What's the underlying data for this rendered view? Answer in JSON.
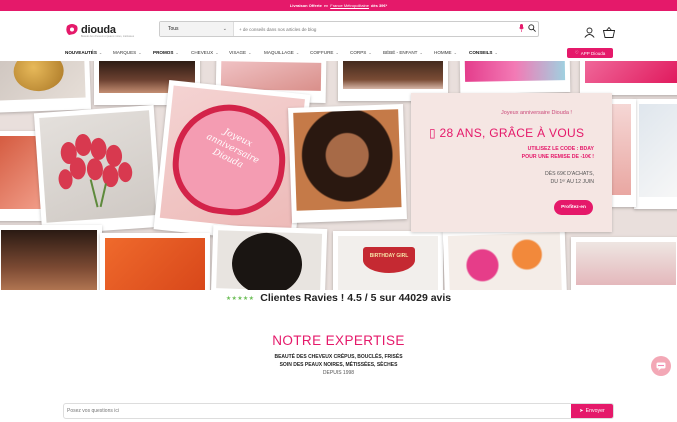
{
  "topbar": {
    "prefix": "Livraison Offerte",
    "mid": "en",
    "link": "France Métropolitaine",
    "suffix": "dès 39€*"
  },
  "brand": {
    "name": "diouda",
    "tagline": "Beauté des cheveux et peaux noires, métissées"
  },
  "search": {
    "category": "Tous",
    "placeholder": "+ de conseils dans nos articles de blog"
  },
  "nav": {
    "items": [
      {
        "label": "NOUVEAUTÉS",
        "bold": true
      },
      {
        "label": "MARQUES",
        "bold": false
      },
      {
        "label": "PROMOS",
        "bold": true
      },
      {
        "label": "CHEVEUX",
        "bold": false
      },
      {
        "label": "VISAGE",
        "bold": false
      },
      {
        "label": "MAQUILLAGE",
        "bold": false
      },
      {
        "label": "COIFFURE",
        "bold": false
      },
      {
        "label": "CORPS",
        "bold": false
      },
      {
        "label": "BÉBÉ - ENFANT",
        "bold": false
      },
      {
        "label": "HOMME",
        "bold": false
      },
      {
        "label": "CONSEILS",
        "bold": true
      }
    ],
    "app_button": "APP Diouda"
  },
  "hero": {
    "greeting": "Joyeux anniversaire Diouda !",
    "headline": "▯ 28 ANS, GRÂCE À VOUS",
    "code_line1": "UTILISEZ LE CODE : BDAY",
    "code_line2": "POUR UNE REMISE DE -10€ !",
    "cond_line1": "DÈS 69€ D'ACHATS,",
    "cond_line2": "DU 1ᵉʳ AU 12 JUIN",
    "cta": "Profitez-en",
    "cake_text": "Joyeux anniversaire Diouda",
    "glass_text": "BIRTHDAY GIRL"
  },
  "reviews": {
    "stars": "★★★★★",
    "text": "Clientes Ravies ! 4.5 / 5 sur 44029 avis"
  },
  "expertise": {
    "title": "NOTRE EXPERTISE",
    "line1": "BEAUTÉ DES CHEVEUX CRÉPUS, BOUCLÉS, FRISÉS",
    "line2": "SOIN DES PEAUX NOIRES, MÉTISSÉES, SÈCHES",
    "line3": "DEPUIS 1998"
  },
  "ask": {
    "placeholder": "Posez vos questions ici",
    "button": "Envoyer"
  },
  "colors": {
    "brand": "#e5196a",
    "promo_bg": "#f5e6e3"
  }
}
